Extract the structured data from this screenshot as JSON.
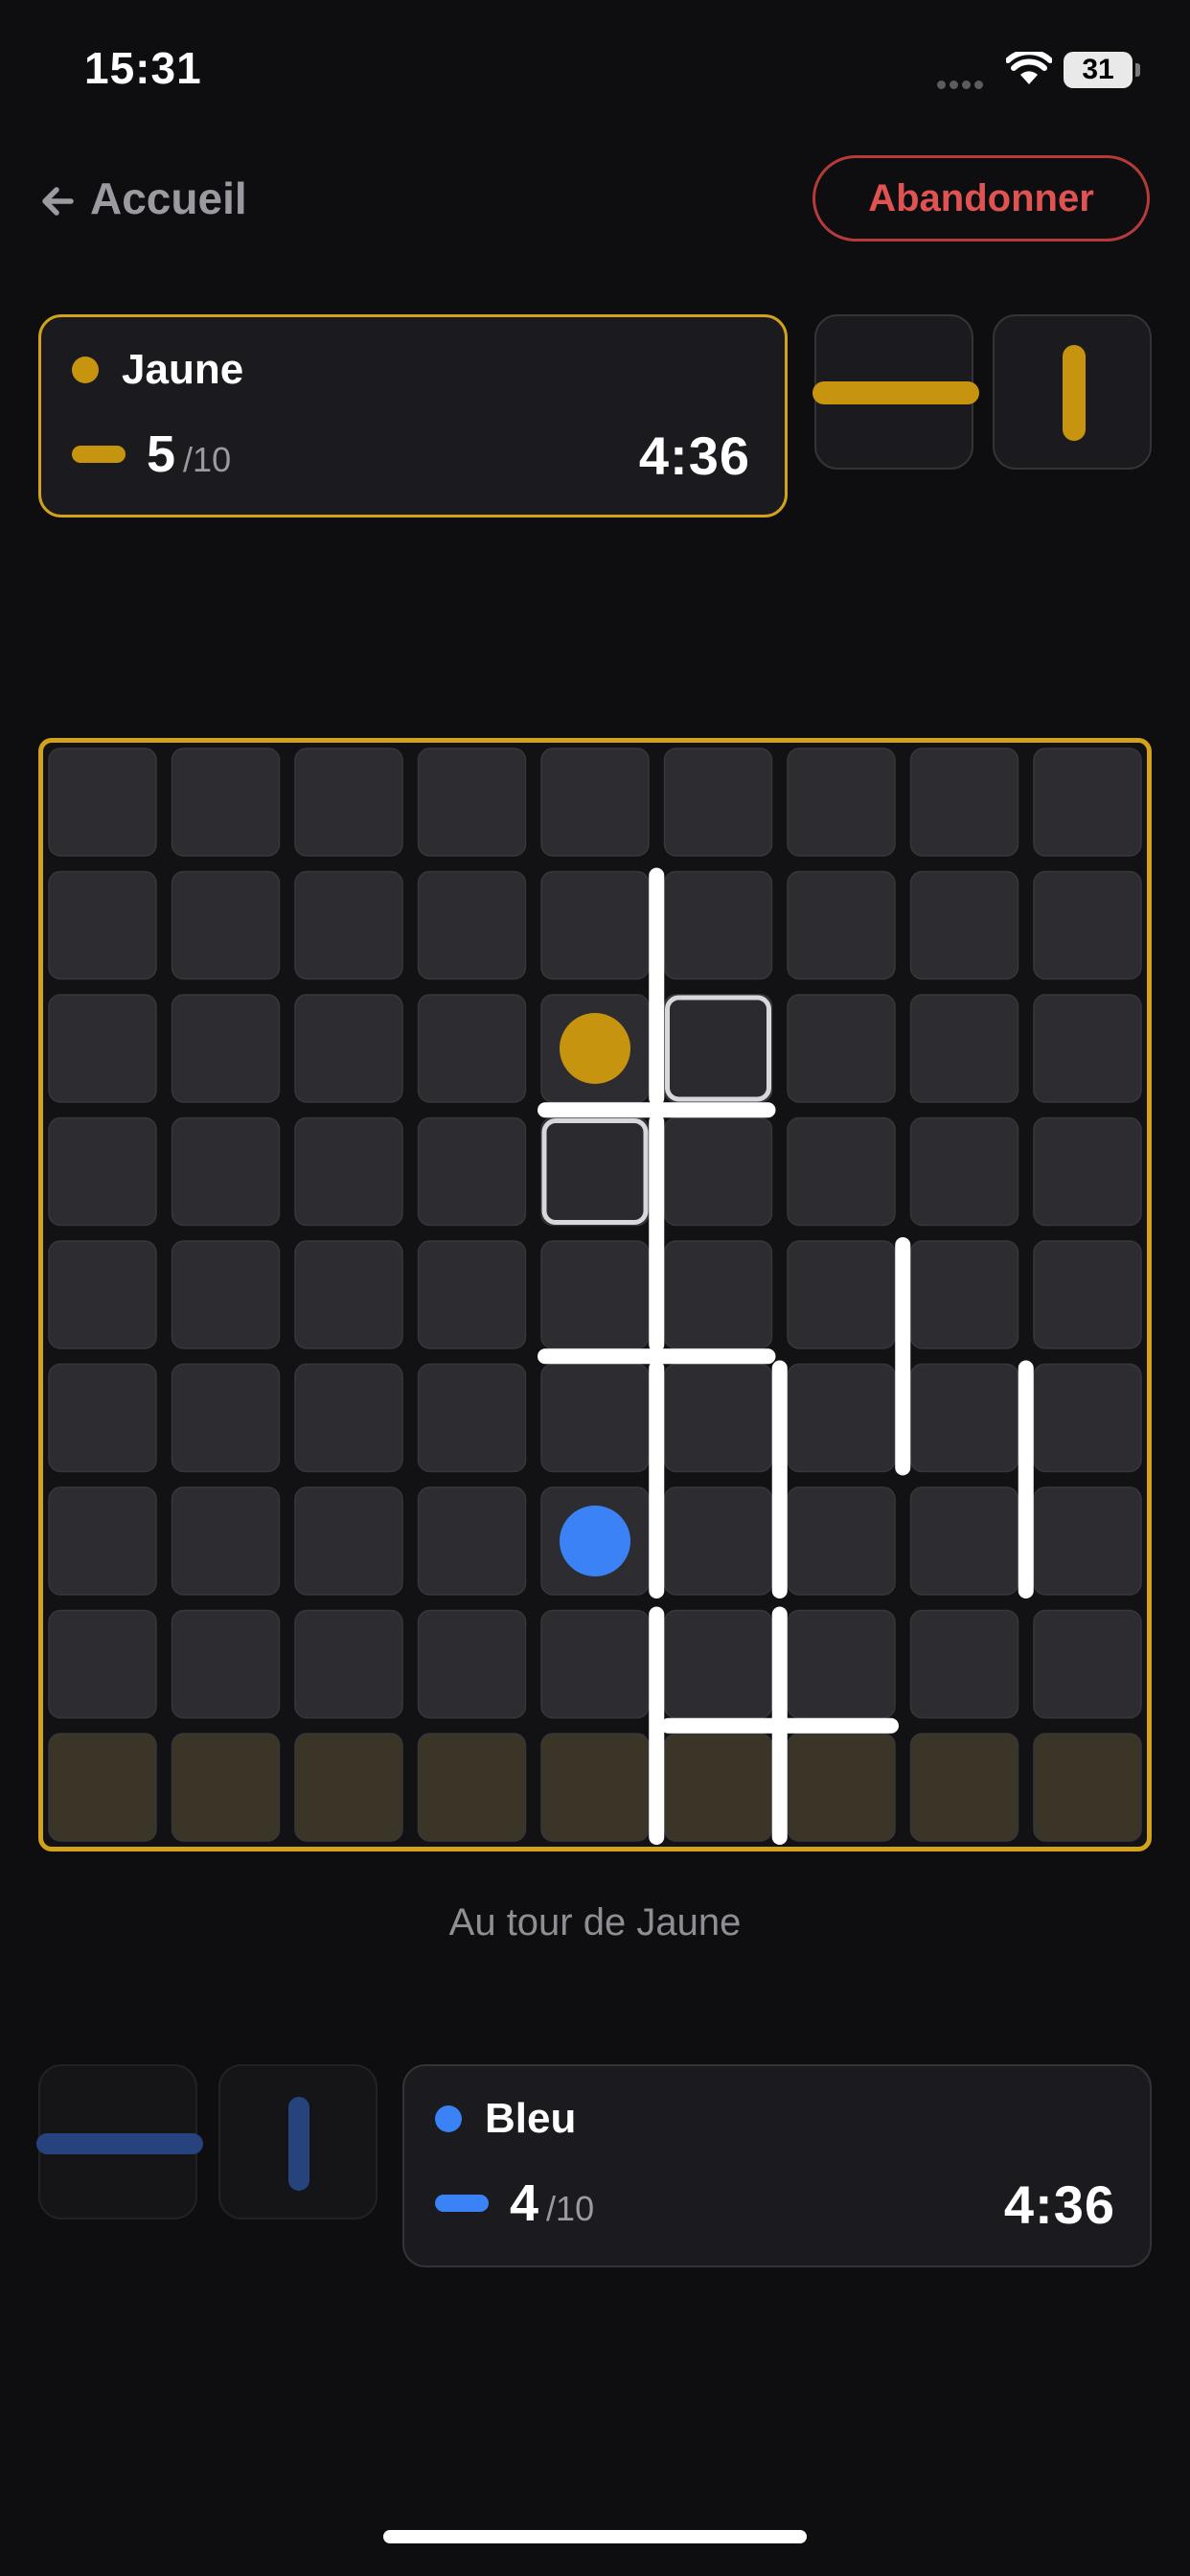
{
  "status_bar": {
    "time": "15:31",
    "battery": "31"
  },
  "header": {
    "back_label": "Accueil",
    "abandon_label": "Abandonner"
  },
  "players": [
    {
      "name": "Jaune",
      "color": "#c7940f",
      "walls_left": "5",
      "walls_total": "/10",
      "timer": "4:36",
      "active": true
    },
    {
      "name": "Bleu",
      "color": "#3b82f6",
      "walls_left": "4",
      "walls_total": "/10",
      "timer": "4:36",
      "active": false
    }
  ],
  "turn_text": "Au tour de Jaune",
  "colors": {
    "accent": "#d3a21c",
    "bleu_inactive": "#24386b",
    "cell": "#2c2c31",
    "goal_cell": "#3a3526",
    "wall": "#ffffff",
    "abandon": "#e05353"
  },
  "board": {
    "size": 9,
    "goal_row": 8,
    "pawns": [
      {
        "player": "Jaune",
        "row": 2,
        "col": 4
      },
      {
        "player": "Bleu",
        "row": 6,
        "col": 4
      }
    ],
    "valid_moves": [
      {
        "row": 2,
        "col": 5
      },
      {
        "row": 3,
        "col": 4
      }
    ],
    "walls": [
      {
        "orientation": "v",
        "row": 1,
        "col": 4
      },
      {
        "orientation": "h",
        "row": 2,
        "col": 4
      },
      {
        "orientation": "v",
        "row": 3,
        "col": 4
      },
      {
        "orientation": "h",
        "row": 4,
        "col": 4
      },
      {
        "orientation": "v",
        "row": 4,
        "col": 6
      },
      {
        "orientation": "v",
        "row": 5,
        "col": 4
      },
      {
        "orientation": "v",
        "row": 5,
        "col": 5
      },
      {
        "orientation": "v",
        "row": 5,
        "col": 7
      },
      {
        "orientation": "h",
        "row": 7,
        "col": 5
      },
      {
        "orientation": "v",
        "row": 7,
        "col": 4
      },
      {
        "orientation": "v",
        "row": 7,
        "col": 5
      }
    ]
  }
}
